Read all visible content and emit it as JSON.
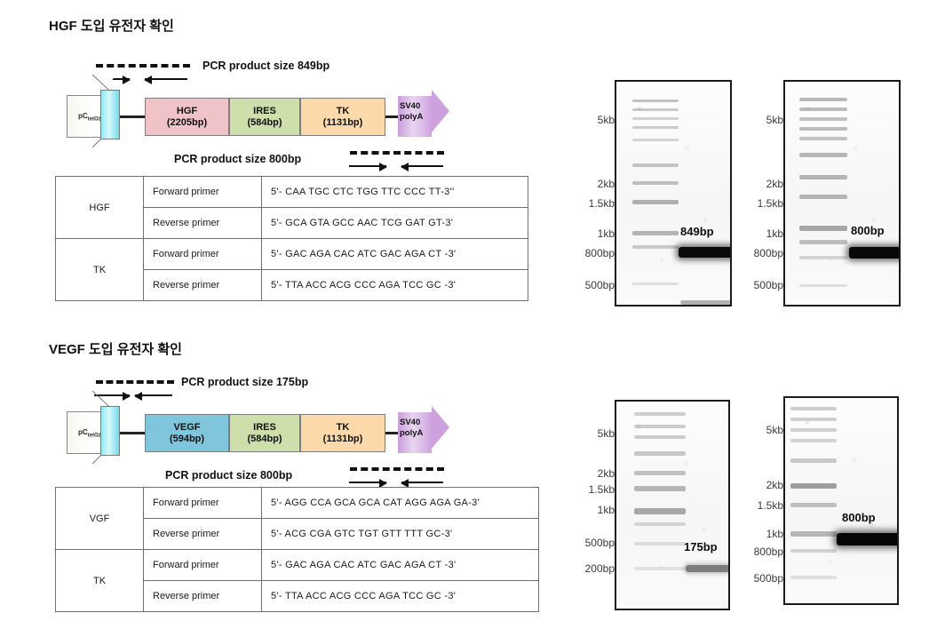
{
  "sections": [
    {
      "title": "HGF 도입 유전자 확인",
      "construct": {
        "promoter_label": "pC",
        "promoter_label_sub": "tetO",
        "promoter_label_sub2": "2",
        "genes": [
          {
            "name": "HGF",
            "size": "(2205bp)",
            "color": "#f0c3c9"
          },
          {
            "name": "IRES",
            "size": "(584bp)",
            "color": "#cfdfab"
          },
          {
            "name": "TK",
            "size": "(1131bp)",
            "color": "#fbd9ab"
          }
        ],
        "polya_line1": "SV40",
        "polya_line2": "polyA",
        "polya_color": "#cda1de",
        "top_annotation": "PCR product  size 849bp",
        "bottom_annotation": "PCR product  size 800bp"
      },
      "table": {
        "rows": [
          {
            "gene": "HGF",
            "kind": "Forward primer",
            "seq": "5'- CAA TGC CTC TGG TTC CCC TT-3''"
          },
          {
            "gene": "HGF",
            "kind": "Reverse primer",
            "seq": "5'- GCA GTA GCC AAC TCG GAT GT-3'"
          },
          {
            "gene": "TK",
            "kind": "Forward primer",
            "seq": "5'- GAC AGA CAC ATC GAC AGA CT -3'"
          },
          {
            "gene": "TK",
            "kind": "Reverse primer",
            "seq": "5'- TTA ACC ACG CCC AGA TCC GC -3'"
          }
        ]
      },
      "gels": [
        {
          "ladder_marks": [
            "5kb",
            "2kb",
            "1.5kb",
            "1kb",
            "800bp",
            "500bp"
          ],
          "band_label": "849bp"
        },
        {
          "ladder_marks": [
            "5kb",
            "2kb",
            "1.5kb",
            "1kb",
            "800bp",
            "500bp"
          ],
          "band_label": "800bp"
        }
      ]
    },
    {
      "title": "VEGF 도입 유전자 확인",
      "construct": {
        "promoter_label": "pC",
        "promoter_label_sub": "tetO",
        "promoter_label_sub2": "2",
        "genes": [
          {
            "name": "VEGF",
            "size": "(594bp)",
            "color": "#7fc6dd"
          },
          {
            "name": "IRES",
            "size": "(584bp)",
            "color": "#cfdfab"
          },
          {
            "name": "TK",
            "size": "(1131bp)",
            "color": "#fbd9ab"
          }
        ],
        "polya_line1": "SV40",
        "polya_line2": "polyA",
        "polya_color": "#cda1de",
        "top_annotation": "PCR product  size 175bp",
        "bottom_annotation": "PCR product  size 800bp"
      },
      "table": {
        "rows": [
          {
            "gene": "VGF",
            "kind": "Forward primer",
            "seq": "5'- AGG CCA GCA GCA CAT AGG AGA GA-3'"
          },
          {
            "gene": "VGF",
            "kind": "Reverse primer",
            "seq": "5'- ACG CGA GTC TGT GTT TTT GC-3'"
          },
          {
            "gene": "TK",
            "kind": "Forward primer",
            "seq": "5'- GAC AGA CAC ATC GAC AGA CT -3'"
          },
          {
            "gene": "TK",
            "kind": "Reverse primer",
            "seq": "5'- TTA ACC ACG CCC AGA TCC GC -3'"
          }
        ]
      },
      "gels": [
        {
          "ladder_marks": [
            "5kb",
            "2kb",
            "1.5kb",
            "1kb",
            "500bp",
            "200bp"
          ],
          "band_label": "175bp"
        },
        {
          "ladder_marks": [
            "5kb",
            "2kb",
            "1.5kb",
            "1kb",
            "800bp",
            "500bp"
          ],
          "band_label": "800bp"
        }
      ]
    }
  ]
}
